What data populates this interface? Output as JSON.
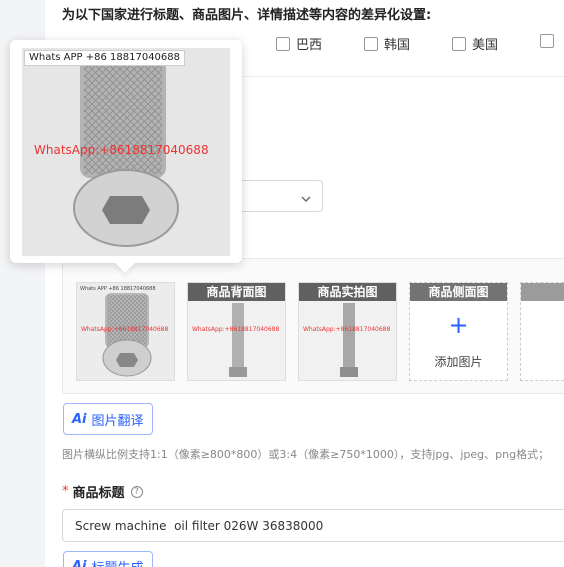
{
  "section": {
    "heading": "为以下国家进行标题、商品图片、详情描述等内容的差异化设置:"
  },
  "countries": [
    {
      "label": "巴西"
    },
    {
      "label": "韩国"
    },
    {
      "label": "美国"
    }
  ],
  "images": {
    "watermark": "WhatsApp:+8618817040688",
    "tag": "Whats APP +86 18817040688",
    "slots": [
      {
        "caption": ""
      },
      {
        "caption": "商品背面图"
      },
      {
        "caption": "商品实拍图"
      },
      {
        "caption": "商品侧面图",
        "add_label": "添加图片",
        "plus": "+"
      }
    ]
  },
  "buttons": {
    "image_translate": "图片翻译",
    "title_generate": "标题生成",
    "ai_icon": "Ai"
  },
  "hint": "图片横纵比例支持1:1（像素≥800*800）或3:4（像素≥750*1000），支持jpg、jpeg、png格式；",
  "title_field": {
    "required_mark": "*",
    "label": "商品标题",
    "help": "?",
    "value": "Screw machine  oil filter 026W 36838000"
  },
  "popover": {
    "tag": "Whats APP +86 18817040688",
    "watermark": "WhatsApp:+8618817040688"
  },
  "select": {
    "chevron": "⌄"
  }
}
